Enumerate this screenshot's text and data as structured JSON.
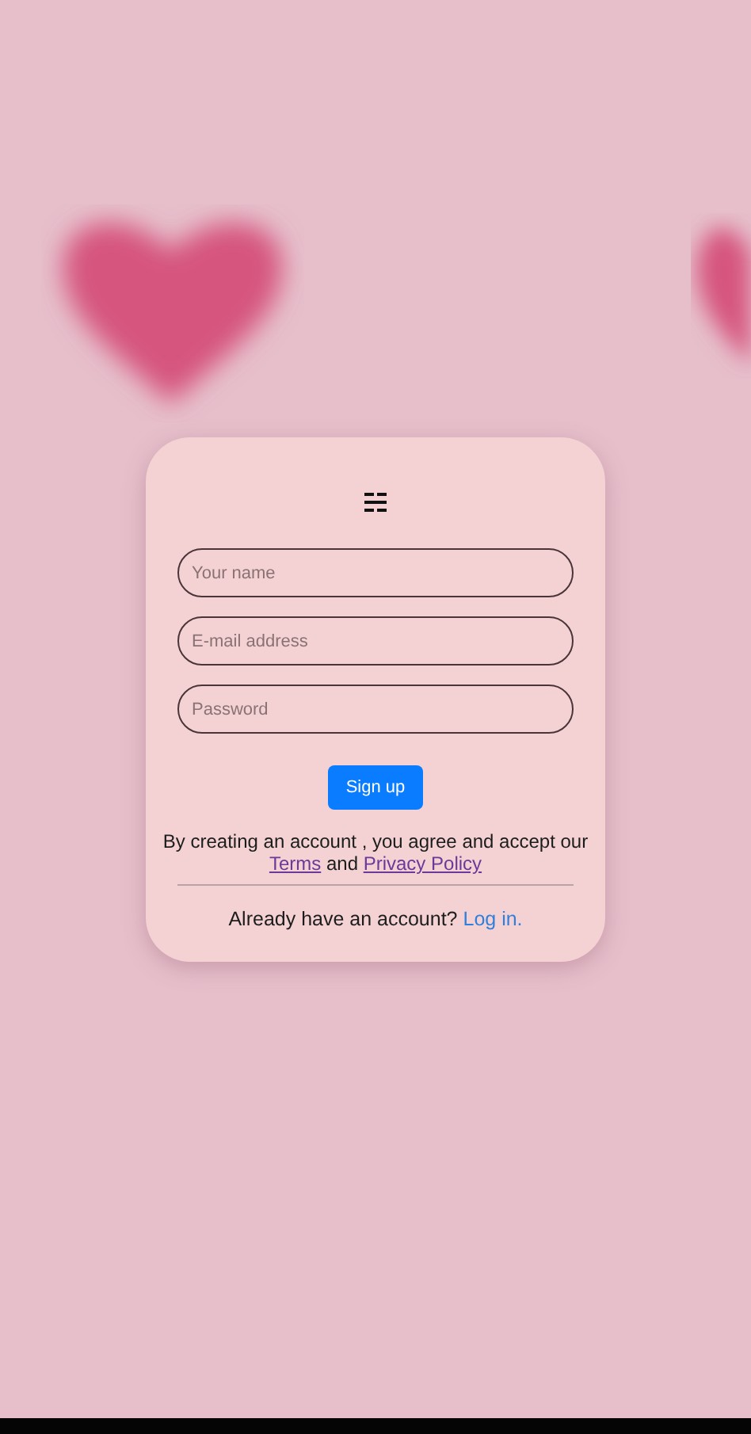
{
  "form": {
    "fields": [
      {
        "placeholder": "Your name"
      },
      {
        "placeholder": "E-mail address"
      },
      {
        "placeholder": "Password"
      }
    ],
    "submit": "Sign up",
    "agreement": {
      "text": "By creating an account , you agree and accept our",
      "links": [
        "Terms",
        "Privacy Policy"
      ],
      "joiner": "and"
    },
    "login": {
      "text": "Already have an account?",
      "link": "Log in."
    }
  }
}
